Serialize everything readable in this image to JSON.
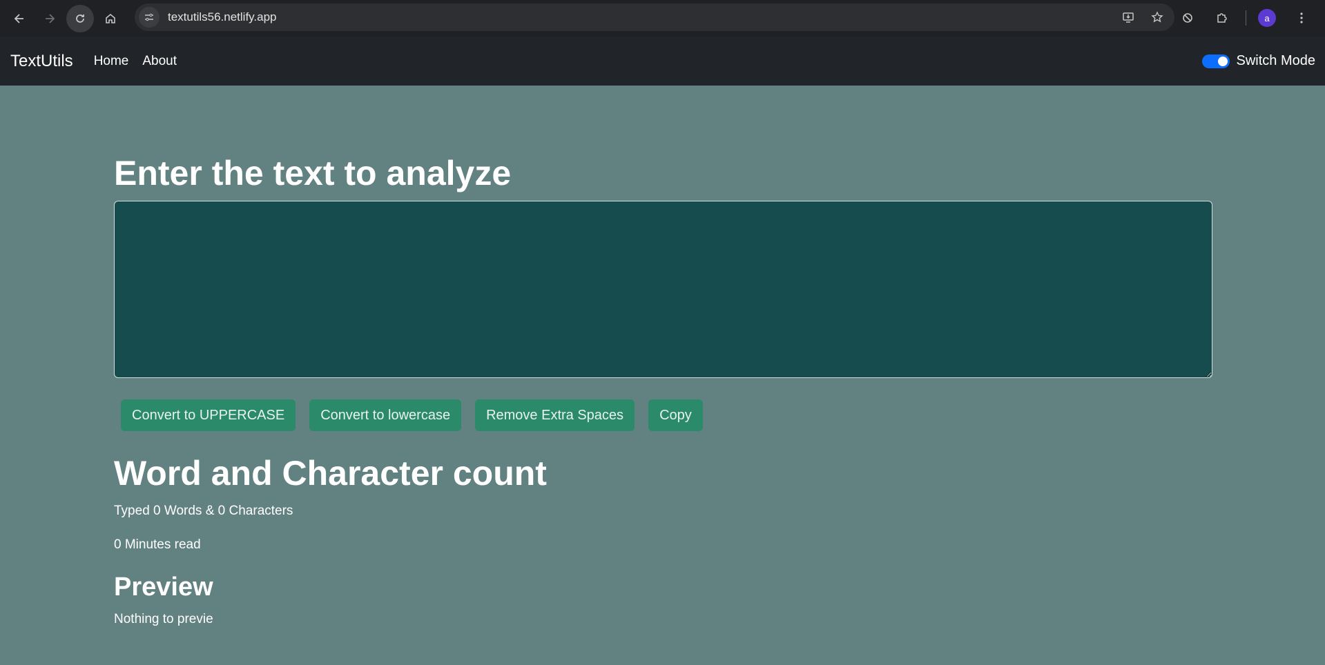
{
  "browser": {
    "url": "textutils56.netlify.app",
    "profile_initial": "a"
  },
  "navbar": {
    "brand": "TextUtils",
    "links": [
      "Home",
      "About"
    ],
    "switch_label": "Switch Mode",
    "switch_on": true
  },
  "main": {
    "heading": "Enter the text to analyze",
    "textarea_value": "",
    "buttons": [
      "Convert to UPPERCASE",
      "Convert to lowercase",
      "Remove Extra Spaces",
      "Copy"
    ],
    "summary_heading": "Word and Character count",
    "summary_text": "Typed 0 Words & 0 Characters",
    "read_time": "0 Minutes read",
    "preview_heading": "Preview",
    "preview_text": "Nothing to previe"
  },
  "colors": {
    "page_bg": "#628282",
    "navbar_bg": "#212529",
    "textarea_bg": "#164c4d",
    "button_bg": "#2a8a6a",
    "toggle_accent": "#0d6efd"
  }
}
